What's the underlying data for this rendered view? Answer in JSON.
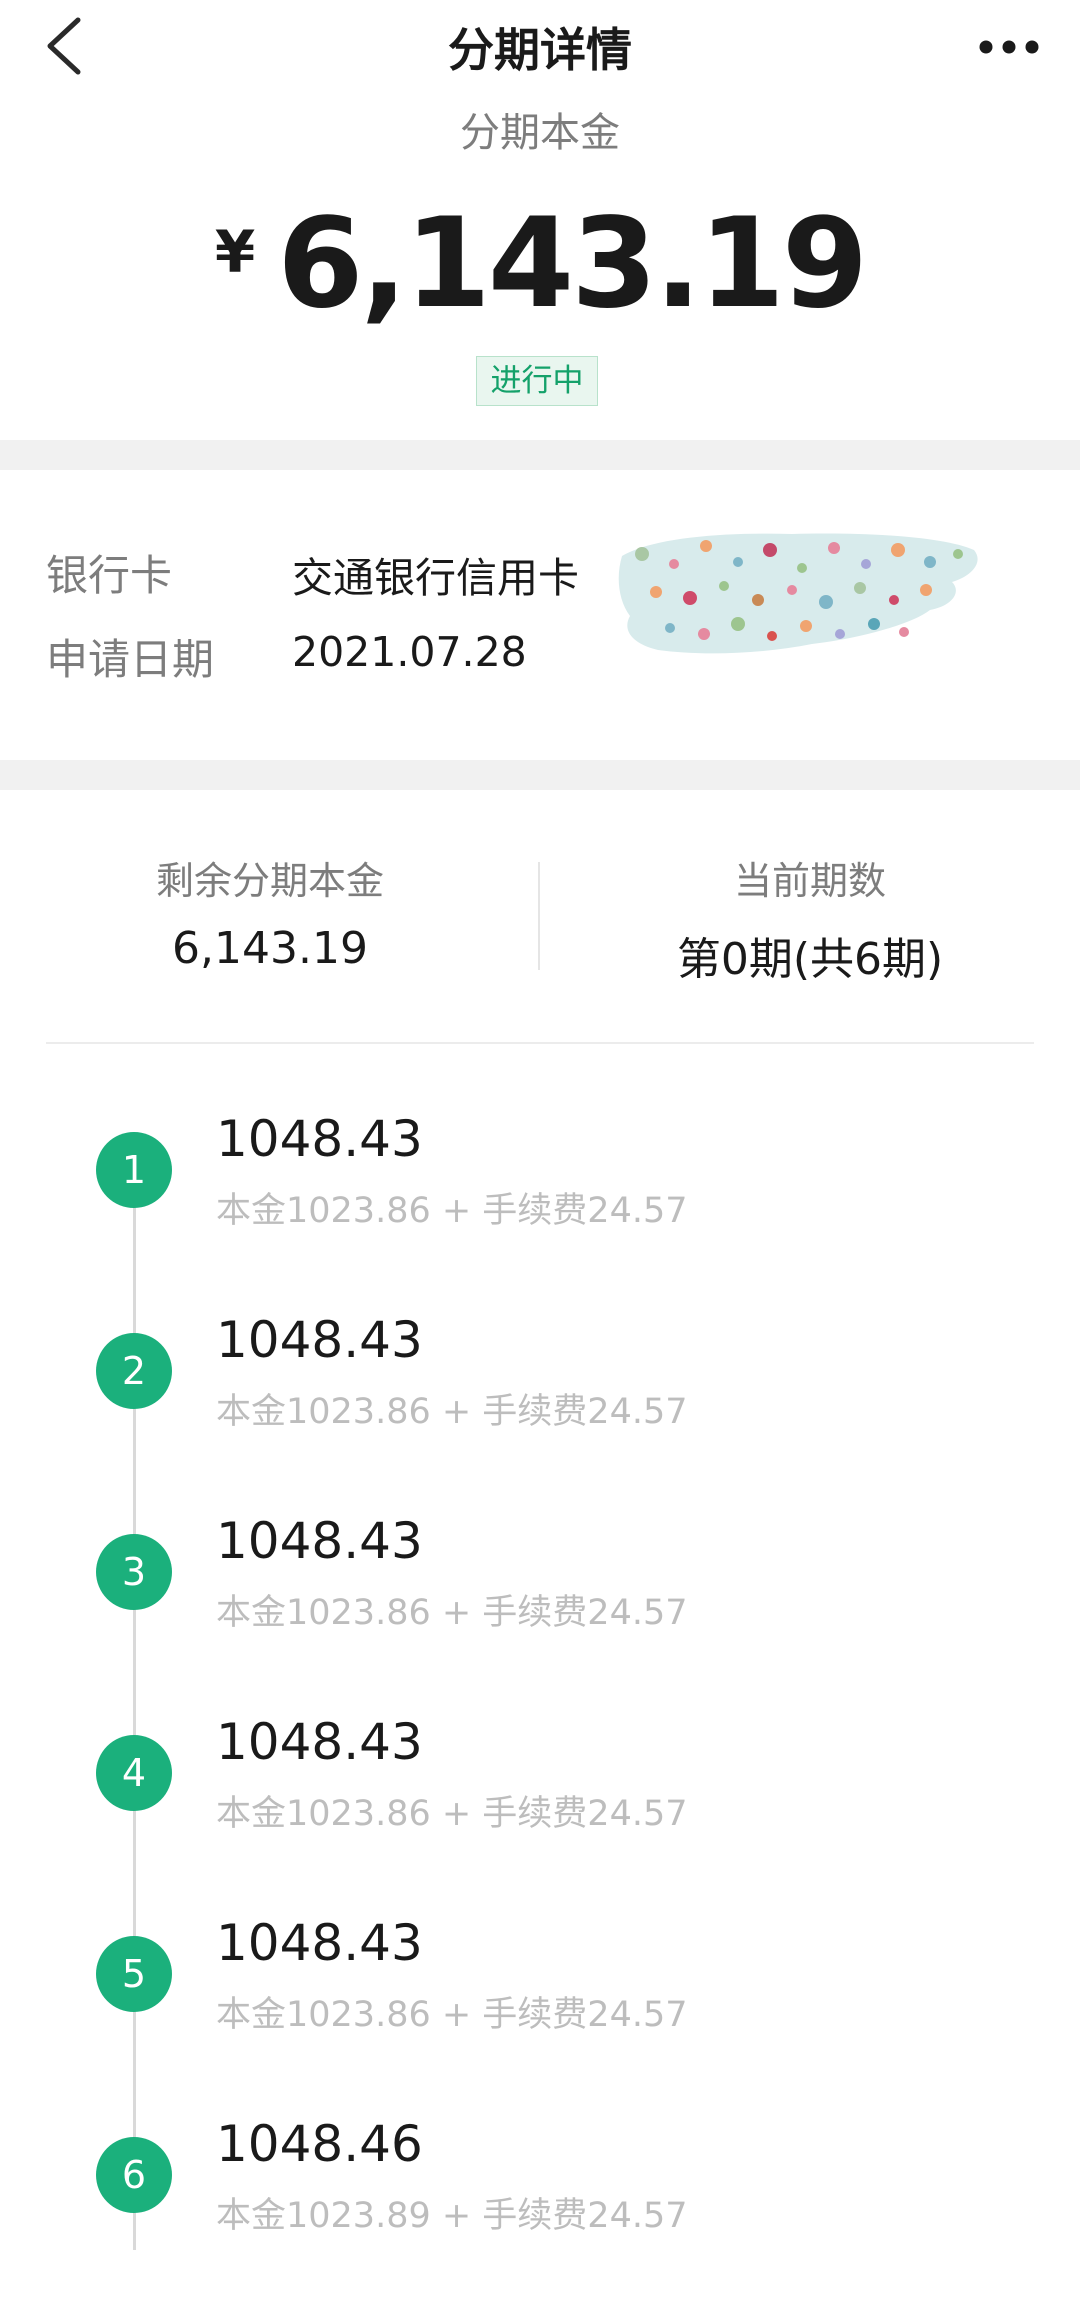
{
  "header": {
    "title": "分期详情"
  },
  "summary": {
    "principal_label": "分期本金",
    "currency_symbol": "¥",
    "amount": "6,143.19",
    "status": "进行中",
    "status_color": "#14a16a"
  },
  "info": {
    "bank_card_label": "银行卡",
    "bank_card_value": "交通银行信用卡",
    "apply_date_label": "申请日期",
    "apply_date_value": "2021.07.28"
  },
  "stats": {
    "remaining_label": "剩余分期本金",
    "remaining_value": "6,143.19",
    "current_period_label": "当前期数",
    "current_period_value": "第0期(共6期)"
  },
  "schedule": {
    "accent_color": "#1bb07c",
    "periods": [
      {
        "num": "1",
        "amount": "1048.43",
        "detail": "本金1023.86 + 手续费24.57"
      },
      {
        "num": "2",
        "amount": "1048.43",
        "detail": "本金1023.86 + 手续费24.57"
      },
      {
        "num": "3",
        "amount": "1048.43",
        "detail": "本金1023.86 + 手续费24.57"
      },
      {
        "num": "4",
        "amount": "1048.43",
        "detail": "本金1023.86 + 手续费24.57"
      },
      {
        "num": "5",
        "amount": "1048.43",
        "detail": "本金1023.86 + 手续费24.57"
      },
      {
        "num": "6",
        "amount": "1048.46",
        "detail": "本金1023.89 + 手续费24.57"
      }
    ]
  },
  "icons": {
    "back": "chevron-left-icon",
    "more": "more-horizontal-icon"
  }
}
